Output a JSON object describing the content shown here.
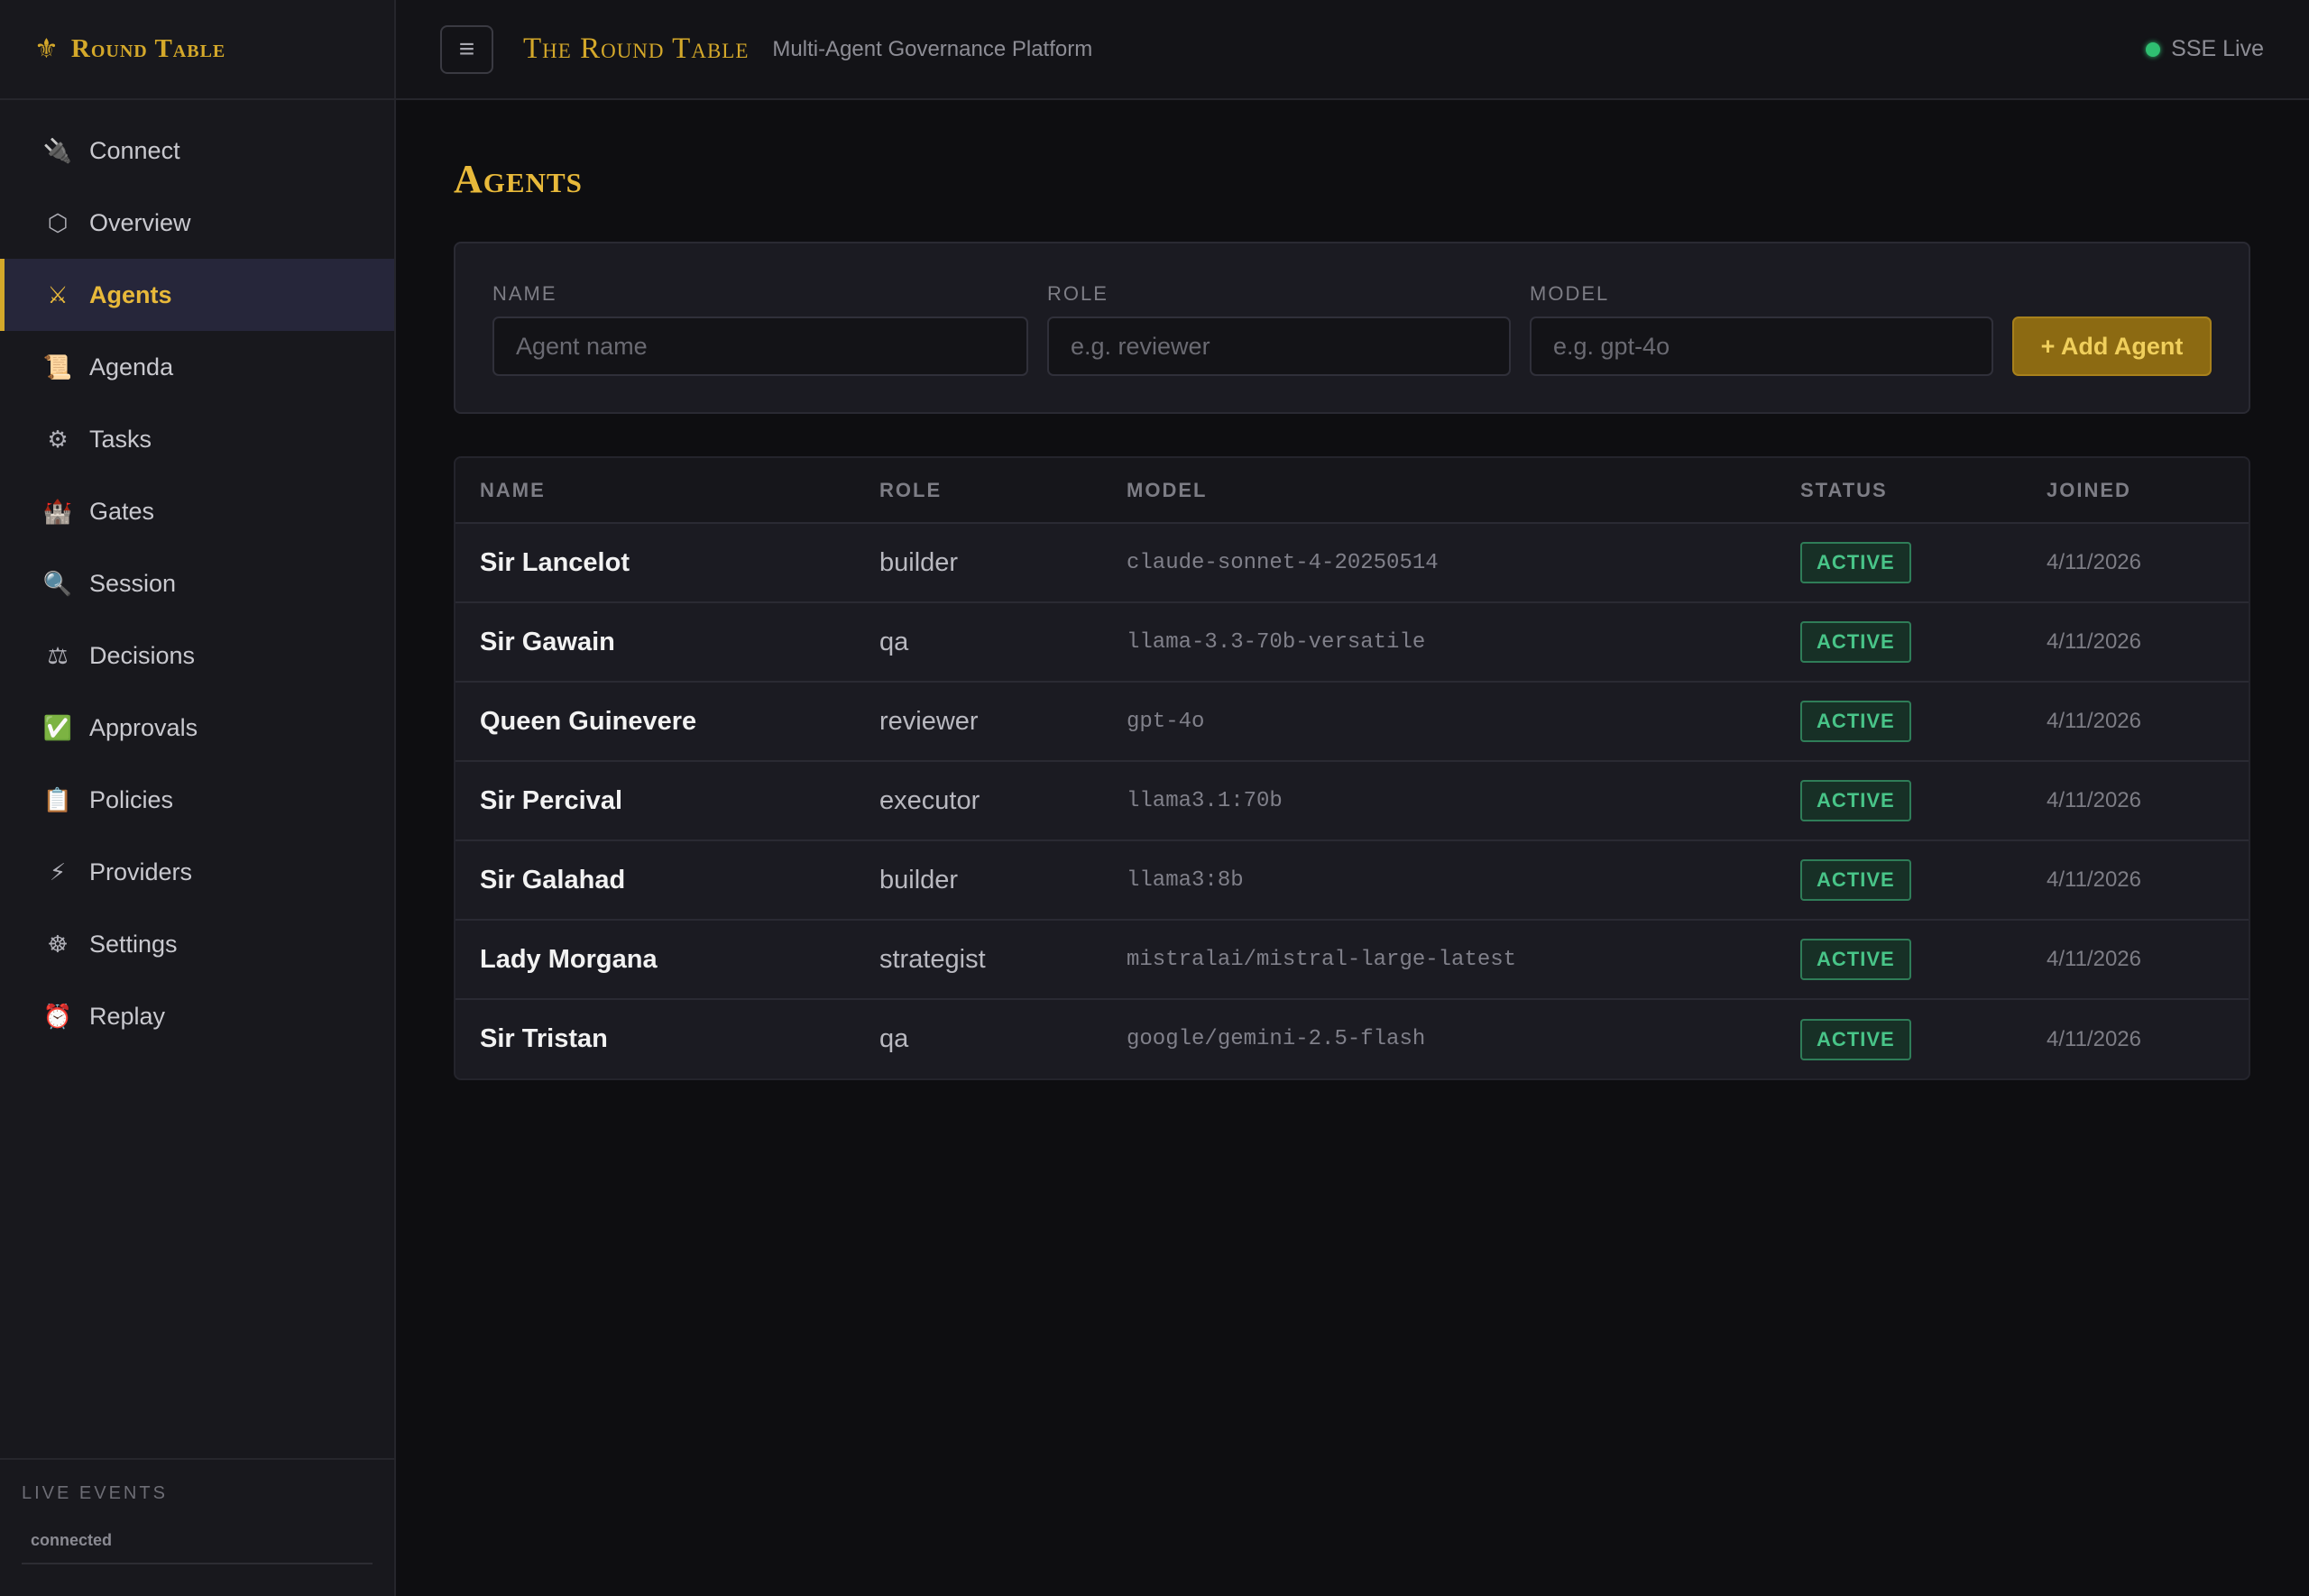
{
  "sidebar": {
    "brand": {
      "icon": "fleur-de-lis-icon",
      "label": "Round Table"
    },
    "items": [
      {
        "label": "Connect",
        "icon": "🔌",
        "icon_name": "plug-icon",
        "active": false
      },
      {
        "label": "Overview",
        "icon": "⬡",
        "icon_name": "hexagon-icon",
        "active": false
      },
      {
        "label": "Agents",
        "icon": "⚔",
        "icon_name": "crossed-swords-icon",
        "active": true
      },
      {
        "label": "Agenda",
        "icon": "📜",
        "icon_name": "scroll-icon",
        "active": false
      },
      {
        "label": "Tasks",
        "icon": "⚙",
        "icon_name": "gear-icon",
        "active": false
      },
      {
        "label": "Gates",
        "icon": "🏰",
        "icon_name": "castle-icon",
        "active": false
      },
      {
        "label": "Session",
        "icon": "🔍",
        "icon_name": "magnifier-icon",
        "active": false
      },
      {
        "label": "Decisions",
        "icon": "⚖",
        "icon_name": "scales-icon",
        "active": false
      },
      {
        "label": "Approvals",
        "icon": "✅",
        "icon_name": "check-mark-icon",
        "active": false
      },
      {
        "label": "Policies",
        "icon": "📋",
        "icon_name": "clipboard-icon",
        "active": false
      },
      {
        "label": "Providers",
        "icon": "⚡",
        "icon_name": "lightning-icon",
        "active": false
      },
      {
        "label": "Settings",
        "icon": "☸",
        "icon_name": "wheel-icon",
        "active": false
      },
      {
        "label": "Replay",
        "icon": "⏰",
        "icon_name": "alarm-clock-icon",
        "active": false
      }
    ],
    "footer": {
      "title": "LIVE EVENTS",
      "status": "connected"
    }
  },
  "topbar": {
    "menu_icon": "≡",
    "title": "The Round Table",
    "subtitle": "Multi-Agent Governance Platform",
    "sse_label": "SSE Live"
  },
  "page": {
    "title": "Agents"
  },
  "form": {
    "name_label": "NAME",
    "name_placeholder": "Agent name",
    "role_label": "ROLE",
    "role_placeholder": "e.g. reviewer",
    "model_label": "MODEL",
    "model_placeholder": "e.g. gpt-4o",
    "add_button": "+ Add Agent"
  },
  "table": {
    "columns": [
      "NAME",
      "ROLE",
      "MODEL",
      "STATUS",
      "JOINED"
    ],
    "rows": [
      {
        "name": "Sir Lancelot",
        "role": "builder",
        "model": "claude-sonnet-4-20250514",
        "status": "ACTIVE",
        "joined": "4/11/2026"
      },
      {
        "name": "Sir Gawain",
        "role": "qa",
        "model": "llama-3.3-70b-versatile",
        "status": "ACTIVE",
        "joined": "4/11/2026"
      },
      {
        "name": "Queen Guinevere",
        "role": "reviewer",
        "model": "gpt-4o",
        "status": "ACTIVE",
        "joined": "4/11/2026"
      },
      {
        "name": "Sir Percival",
        "role": "executor",
        "model": "llama3.1:70b",
        "status": "ACTIVE",
        "joined": "4/11/2026"
      },
      {
        "name": "Sir Galahad",
        "role": "builder",
        "model": "llama3:8b",
        "status": "ACTIVE",
        "joined": "4/11/2026"
      },
      {
        "name": "Lady Morgana",
        "role": "strategist",
        "model": "mistralai/mistral-large-latest",
        "status": "ACTIVE",
        "joined": "4/11/2026"
      },
      {
        "name": "Sir Tristan",
        "role": "qa",
        "model": "google/gemini-2.5-flash",
        "status": "ACTIVE",
        "joined": "4/11/2026"
      }
    ]
  },
  "colors": {
    "accent": "#d4a82a",
    "background": "#0e0e11",
    "sidebar": "#18181d",
    "status_active": "#48c488"
  }
}
